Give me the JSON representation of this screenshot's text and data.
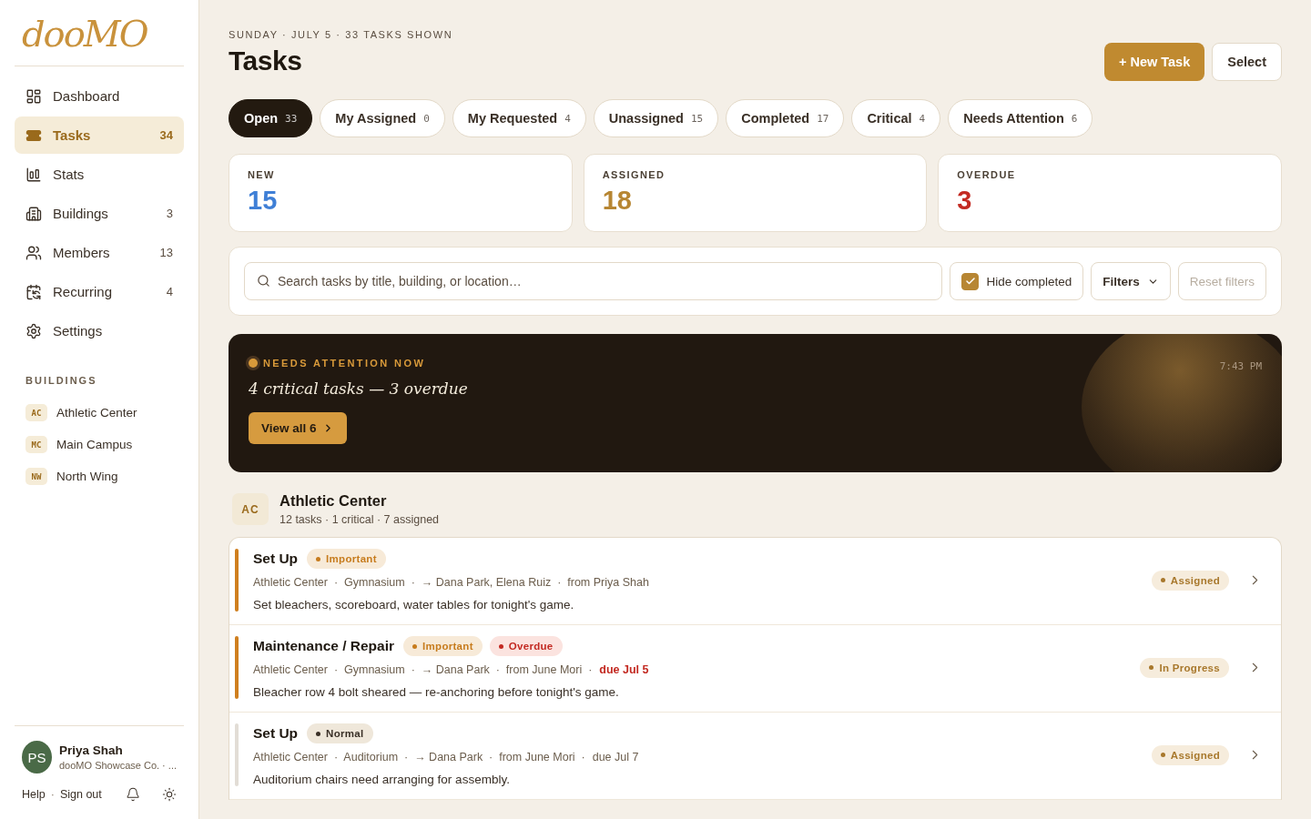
{
  "sidebar": {
    "logo": "dooMO",
    "nav": [
      {
        "kind": "dashboard",
        "label": "Dashboard",
        "selected": false
      },
      {
        "kind": "tasks",
        "label": "Tasks",
        "count": "34",
        "selected": true
      },
      {
        "kind": "stats",
        "label": "Stats",
        "selected": false
      },
      {
        "kind": "buildings",
        "label": "Buildings",
        "count": "3",
        "selected": false
      },
      {
        "kind": "members",
        "label": "Members",
        "count": "13",
        "selected": false
      },
      {
        "kind": "recurring",
        "label": "Recurring",
        "count": "4",
        "selected": false
      },
      {
        "kind": "settings",
        "label": "Settings",
        "selected": false
      }
    ],
    "buildings_heading": "BUILDINGS",
    "buildings": [
      {
        "code": "AC",
        "name": "Athletic Center"
      },
      {
        "code": "MC",
        "name": "Main Campus"
      },
      {
        "code": "NW",
        "name": "North Wing"
      }
    ],
    "user": {
      "initials": "PS",
      "name": "Priya Shah",
      "org": "dooMO Showcase Co. · ..."
    },
    "links": [
      "Help",
      "Sign out"
    ],
    "links_separator": "·"
  },
  "header": {
    "eyebrow": "SUNDAY · JULY 5 · 33 TASKS SHOWN",
    "title": "Tasks",
    "buttons": [
      {
        "kind": "primary",
        "label": "+ New Task"
      },
      {
        "kind": "secondary",
        "label": "Select"
      }
    ]
  },
  "tabs": [
    {
      "label": "Open",
      "count": "33",
      "selected": true
    },
    {
      "label": "My Assigned",
      "count": "0",
      "selected": false
    },
    {
      "label": "My Requested",
      "count": "4",
      "selected": false
    },
    {
      "label": "Unassigned",
      "count": "15",
      "selected": false
    },
    {
      "label": "Completed",
      "count": "17",
      "selected": false
    },
    {
      "label": "Critical",
      "count": "4",
      "selected": false
    },
    {
      "label": "Needs Attention",
      "count": "6",
      "selected": false
    }
  ],
  "stats": [
    {
      "kind": "new",
      "label": "NEW",
      "value": "15"
    },
    {
      "kind": "assigned",
      "label": "ASSIGNED",
      "value": "18"
    },
    {
      "kind": "overdue",
      "label": "OVERDUE",
      "value": "3"
    }
  ],
  "filters": {
    "placeholder": "Search tasks by title, building, or location…",
    "hide_completed": {
      "label": "Hide completed",
      "checked": true
    },
    "filters_button": "Filters",
    "reset": {
      "label": "Reset filters",
      "disabled": true
    }
  },
  "alert": {
    "eyebrow": "NEEDS ATTENTION NOW",
    "headline": "4 critical tasks — 3 overdue",
    "time": "7:43 PM",
    "button": "View all 6"
  },
  "group": {
    "code": "AC",
    "name": "Athletic Center",
    "summary": "12 tasks · 1 critical · 7 assigned",
    "tasks": [
      {
        "title": "Set Up",
        "badges": [
          {
            "kind": "important",
            "label": "Important"
          }
        ],
        "meta": "Athletic Center  ·  Gymnasium  ·  → Dana Park, Elena Ruiz  ·  from Priya Shah",
        "description": "Set bleachers, scoreboard, water tables for tonight's game.",
        "status": "Assigned"
      },
      {
        "title": "Maintenance / Repair",
        "badges": [
          {
            "kind": "important",
            "label": "Important"
          },
          {
            "kind": "overdue",
            "label": "Overdue"
          }
        ],
        "meta": "Athletic Center  ·  Gymnasium  ·  → Dana Park  ·  from June Mori  ·",
        "due": {
          "text": "due Jul 5",
          "overdue": true
        },
        "description": "Bleacher row 4 bolt sheared — re-anchoring before tonight's game.",
        "status": "In Progress"
      },
      {
        "title": "Set Up",
        "badges": [
          {
            "kind": "normal",
            "label": "Normal"
          }
        ],
        "meta": "Athletic Center  ·  Auditorium  ·  → Dana Park  ·  from June Mori  ·",
        "due": {
          "text": "due Jul 7",
          "overdue": false
        },
        "description": "Auditorium chairs need arranging for assembly.",
        "status": "Assigned"
      }
    ]
  }
}
